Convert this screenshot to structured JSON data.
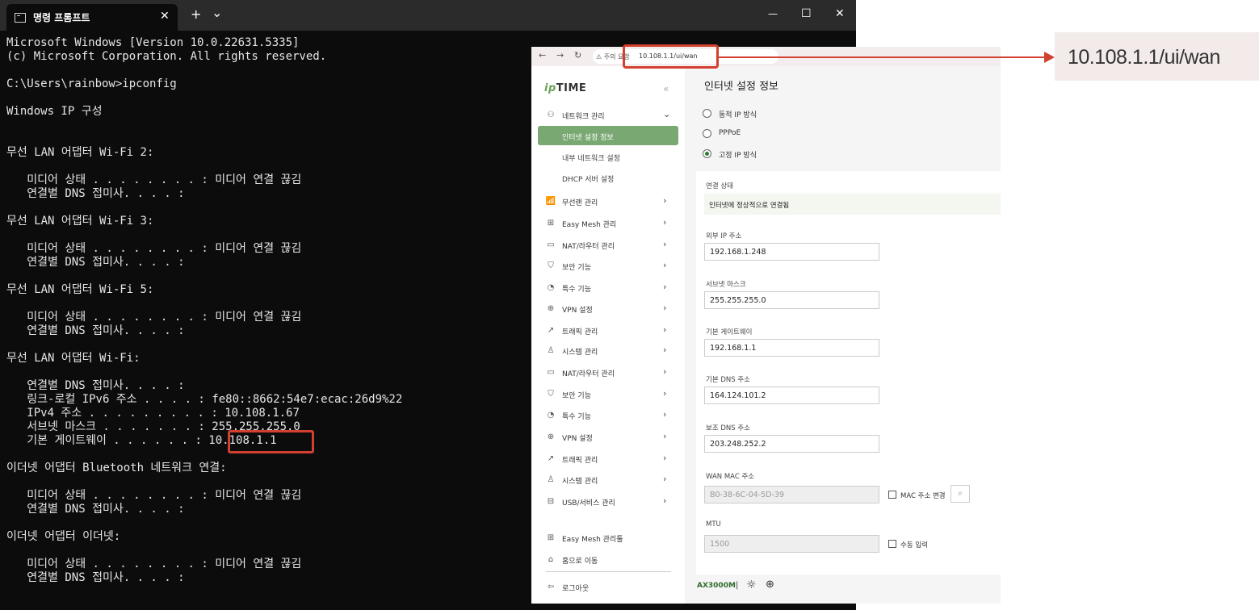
{
  "terminal": {
    "tab_title": "명령 프롬프트",
    "new_tab": "+",
    "dropdown": "⌄",
    "close_tab": "✕",
    "minimize": "—",
    "maximize": "☐",
    "close": "✕",
    "lines": [
      "Microsoft Windows [Version 10.0.22631.5335]",
      "(c) Microsoft Corporation. All rights reserved.",
      "",
      "C:\\Users\\rainbow>ipconfig",
      "",
      "Windows IP 구성",
      "",
      "",
      "무선 LAN 어댑터 Wi-Fi 2:",
      "",
      "   미디어 상태 . . . . . . . . : 미디어 연결 끊김",
      "   연결별 DNS 접미사. . . . :",
      "",
      "무선 LAN 어댑터 Wi-Fi 3:",
      "",
      "   미디어 상태 . . . . . . . . : 미디어 연결 끊김",
      "   연결별 DNS 접미사. . . . :",
      "",
      "무선 LAN 어댑터 Wi-Fi 5:",
      "",
      "   미디어 상태 . . . . . . . . : 미디어 연결 끊김",
      "   연결별 DNS 접미사. . . . :",
      "",
      "무선 LAN 어댑터 Wi-Fi:",
      "",
      "   연결별 DNS 접미사. . . . :",
      "   링크-로컬 IPv6 주소 . . . . : fe80::8662:54e7:ecac:26d9%22",
      "   IPv4 주소 . . . . . . . . . : 10.108.1.67",
      "   서브넷 마스크 . . . . . . . : 255.255.255.0",
      "   기본 게이트웨이 . . . . . . : 10.108.1.1",
      "",
      "이더넷 어댑터 Bluetooth 네트워크 연결:",
      "",
      "   미디어 상태 . . . . . . . . : 미디어 연결 끊김",
      "   연결별 DNS 접미사. . . . :",
      "",
      "이더넷 어댑터 이더넷:",
      "",
      "   미디어 상태 . . . . . . . . : 미디어 연결 끊김",
      "   연결별 DNS 접미사. . . . :"
    ]
  },
  "browser": {
    "back": "←",
    "forward": "→",
    "reload": "↻",
    "security_warning": "⚠ 주의 요함",
    "url": "10.108.1.1/ui/wan"
  },
  "callout": {
    "zoom_text": "10.108.1.1/ui/wan"
  },
  "router": {
    "logo_ip": "ip",
    "logo_rest": "TIME",
    "collapse": "«",
    "menu": [
      {
        "icon": "network-icon",
        "glyph": "⚇",
        "label": "네트워크 관리",
        "chevron": "⌄"
      },
      {
        "icon": "wireless-icon",
        "glyph": "📶",
        "label": "무선랜 관리",
        "chevron": "›"
      },
      {
        "icon": "mesh-icon",
        "glyph": "⊞",
        "label": "Easy Mesh 관리",
        "chevron": "›"
      },
      {
        "icon": "router-icon",
        "glyph": "▭",
        "label": "NAT/라우터 관리",
        "chevron": "›"
      },
      {
        "icon": "shield-icon",
        "glyph": "⛉",
        "label": "보안 기능",
        "chevron": "›"
      },
      {
        "icon": "special-icon",
        "glyph": "◔",
        "label": "특수 기능",
        "chevron": "›"
      },
      {
        "icon": "vpn-icon",
        "glyph": "⊕",
        "label": "VPN 설정",
        "chevron": "›"
      },
      {
        "icon": "traffic-icon",
        "glyph": "↗",
        "label": "트래픽 관리",
        "chevron": "›"
      },
      {
        "icon": "system-icon",
        "glyph": "♙",
        "label": "시스템 관리",
        "chevron": "›"
      },
      {
        "icon": "router-icon",
        "glyph": "▭",
        "label": "NAT/라우터 관리",
        "chevron": "›"
      },
      {
        "icon": "shield-icon",
        "glyph": "⛉",
        "label": "보안 기능",
        "chevron": "›"
      },
      {
        "icon": "special-icon",
        "glyph": "◔",
        "label": "특수 기능",
        "chevron": "›"
      },
      {
        "icon": "vpn-icon",
        "glyph": "⊕",
        "label": "VPN 설정",
        "chevron": "›"
      },
      {
        "icon": "traffic-icon",
        "glyph": "↗",
        "label": "트래픽 관리",
        "chevron": "›"
      },
      {
        "icon": "system-icon",
        "glyph": "♙",
        "label": "시스템 관리",
        "chevron": "›"
      },
      {
        "icon": "usb-icon",
        "glyph": "⊟",
        "label": "USB/서비스 관리",
        "chevron": "›"
      }
    ],
    "submenu": [
      {
        "label": "인터넷 설정 정보",
        "active": true
      },
      {
        "label": "내부 네트워크 설정",
        "active": false
      },
      {
        "label": "DHCP 서버 설정",
        "active": false
      }
    ],
    "bottom_links": [
      {
        "icon": "mesh-tool-icon",
        "glyph": "⊞",
        "label": "Easy Mesh 관리툴"
      },
      {
        "icon": "home-icon",
        "glyph": "⌂",
        "label": "홈으로 이동"
      },
      {
        "icon": "logout-icon",
        "glyph": "⇦",
        "label": "로그아웃"
      }
    ],
    "page_title": "인터넷 설정 정보",
    "radios": [
      {
        "label": "동적 IP 방식",
        "checked": false
      },
      {
        "label": "PPPoE",
        "checked": false
      },
      {
        "label": "고정 IP 방식",
        "checked": true
      }
    ],
    "connection_label": "연결 상태",
    "connection_value": "인터넷에 정상적으로 연결됨",
    "fields": [
      {
        "label": "외부 IP 주소",
        "value": "192.168.1.248"
      },
      {
        "label": "서브넷 마스크",
        "value": "255.255.255.0"
      },
      {
        "label": "기본 게이트웨이",
        "value": "192.168.1.1"
      },
      {
        "label": "기본 DNS 주소",
        "value": "164.124.101.2"
      },
      {
        "label": "보조 DNS 주소",
        "value": "203.248.252.2"
      }
    ],
    "mac_label": "WAN MAC 주소",
    "mac_value": "B0-38-6C-04-5D-39",
    "mac_change": "MAC 주소 변경",
    "mtu_label": "MTU",
    "mtu_value": "1500",
    "manual_input": "수동 입력",
    "model": "AX3000M",
    "footer_sep": "|",
    "colors": {
      "accent": "#7aa873",
      "highlight": "#d2402f"
    }
  }
}
